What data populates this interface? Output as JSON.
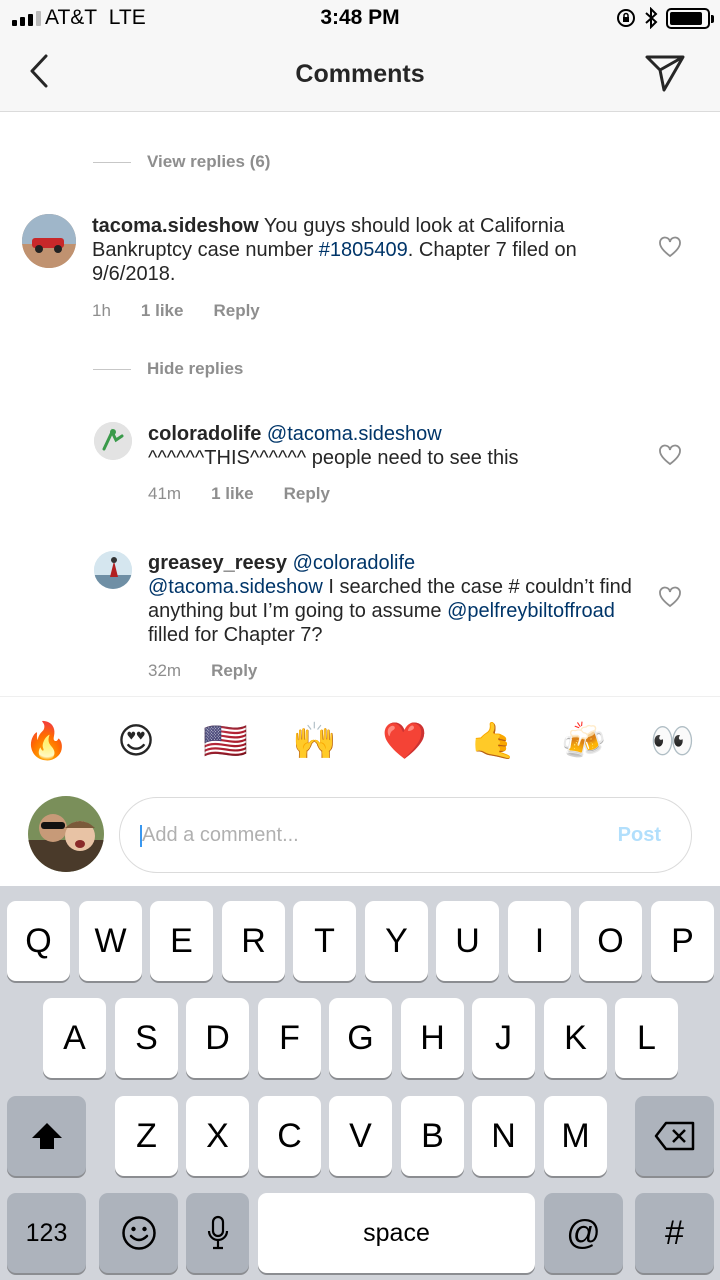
{
  "status_bar": {
    "carrier": "AT&T",
    "network": "LTE",
    "time": "3:48 PM",
    "icons": [
      "signal-icon",
      "rotation-lock-icon",
      "bluetooth-icon",
      "battery-icon"
    ],
    "battery_level": 0.9
  },
  "nav": {
    "title": "Comments",
    "back_icon": "chevron-left-icon",
    "share_icon": "paper-plane-icon"
  },
  "comments": {
    "view_replies": "View replies (6)",
    "hide_replies": "Hide replies",
    "main": {
      "user": "tacoma.sideshow",
      "text_1": " You guys should look at California Bankruptcy case number ",
      "hashtag": "#1805409",
      "text_2": ".  Chapter 7 filed on 9/6/2018.",
      "time": "1h",
      "likes": "1 like",
      "reply": "Reply"
    },
    "replies": [
      {
        "user": "coloradolife",
        "mention_1": "@tacoma.sideshow",
        "text_1": "^^^^^^THIS^^^^^^ people need to see this",
        "time": "41m",
        "likes": "1 like",
        "reply": "Reply"
      },
      {
        "user": "greasey_reesy",
        "mention_1": "@coloradolife",
        "mention_2": "@tacoma.sideshow",
        "text_1": " I searched the case # couldn’t find anything but I’m going to assume ",
        "mention_3": "@pelfreybiltoffroad",
        "text_2": " filled for Chapter 7?",
        "time": "32m",
        "reply": "Reply"
      }
    ]
  },
  "emoji_bar": [
    "🔥",
    "😍",
    "🇺🇸",
    "🙌",
    "❤️",
    "🤙",
    "🍻",
    "👀"
  ],
  "composer": {
    "placeholder": "Add a comment...",
    "post_label": "Post"
  },
  "keyboard": {
    "row1": [
      "Q",
      "W",
      "E",
      "R",
      "T",
      "Y",
      "U",
      "I",
      "O",
      "P"
    ],
    "row2": [
      "A",
      "S",
      "D",
      "F",
      "G",
      "H",
      "J",
      "K",
      "L"
    ],
    "row3": [
      "Z",
      "X",
      "C",
      "V",
      "B",
      "N",
      "M"
    ],
    "numbers_label": "123",
    "space_label": "space",
    "at_label": "@",
    "hash_label": "#"
  }
}
